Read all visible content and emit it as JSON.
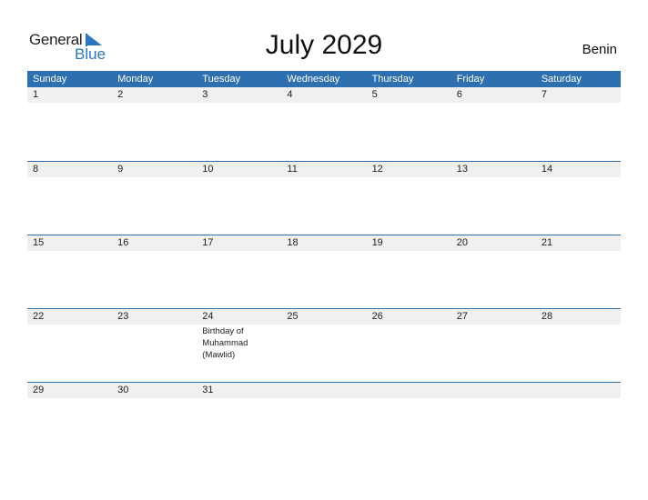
{
  "logo": {
    "word1": "General",
    "word2": "Blue"
  },
  "title": "July 2029",
  "country": "Benin",
  "colors": {
    "header_bg": "#2e6fb0",
    "logo_blue": "#2a77c0",
    "date_strip": "#f0f0f0"
  },
  "weekdays": [
    "Sunday",
    "Monday",
    "Tuesday",
    "Wednesday",
    "Thursday",
    "Friday",
    "Saturday"
  ],
  "weeks": [
    {
      "days": [
        {
          "num": "1"
        },
        {
          "num": "2"
        },
        {
          "num": "3"
        },
        {
          "num": "4"
        },
        {
          "num": "5"
        },
        {
          "num": "6"
        },
        {
          "num": "7"
        }
      ]
    },
    {
      "days": [
        {
          "num": "8"
        },
        {
          "num": "9"
        },
        {
          "num": "10"
        },
        {
          "num": "11"
        },
        {
          "num": "12"
        },
        {
          "num": "13"
        },
        {
          "num": "14"
        }
      ]
    },
    {
      "days": [
        {
          "num": "15"
        },
        {
          "num": "16"
        },
        {
          "num": "17"
        },
        {
          "num": "18"
        },
        {
          "num": "19"
        },
        {
          "num": "20"
        },
        {
          "num": "21"
        }
      ]
    },
    {
      "days": [
        {
          "num": "22"
        },
        {
          "num": "23"
        },
        {
          "num": "24",
          "event": "Birthday of Muhammad (Mawlid)"
        },
        {
          "num": "25"
        },
        {
          "num": "26"
        },
        {
          "num": "27"
        },
        {
          "num": "28"
        }
      ]
    },
    {
      "days": [
        {
          "num": "29"
        },
        {
          "num": "30"
        },
        {
          "num": "31"
        },
        {
          "num": ""
        },
        {
          "num": ""
        },
        {
          "num": ""
        },
        {
          "num": ""
        }
      ]
    }
  ]
}
